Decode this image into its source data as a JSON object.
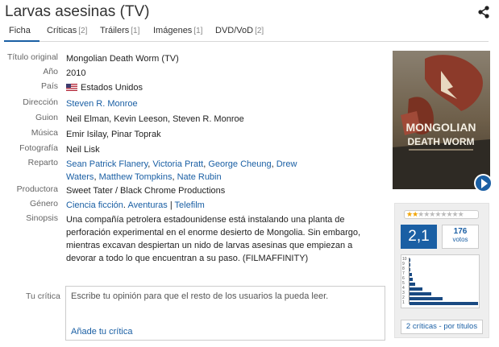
{
  "title": "Larvas asesinas (TV)",
  "share_icon": "share-icon",
  "tabs": [
    {
      "label": "Ficha",
      "count": ""
    },
    {
      "label": "Críticas",
      "count": "[2]"
    },
    {
      "label": "Tráilers",
      "count": "[1]"
    },
    {
      "label": "Imágenes",
      "count": "[1]"
    },
    {
      "label": "DVD/VoD",
      "count": "[2]"
    }
  ],
  "info": {
    "titulo_label": "Título original",
    "titulo": "Mongolian Death Worm (TV)",
    "ano_label": "Año",
    "ano": "2010",
    "pais_label": "País",
    "pais": "Estados Unidos",
    "direccion_label": "Dirección",
    "direccion": "Steven R. Monroe",
    "guion_label": "Guion",
    "guion": "Neil Elman, Kevin Leeson, Steven R. Monroe",
    "musica_label": "Música",
    "musica": "Emir Isilay, Pinar Toprak",
    "fotografia_label": "Fotografía",
    "fotografia": "Neil Lisk",
    "reparto_label": "Reparto",
    "reparto": [
      "Sean Patrick Flanery",
      "Victoria Pratt",
      "George Cheung",
      "Drew Waters",
      "Matthew Tompkins",
      "Nate Rubin"
    ],
    "productora_label": "Productora",
    "productora": "Sweet Tater / Black Chrome Productions",
    "genero_label": "Género",
    "genero": [
      "Ciencia ficción",
      "Aventuras",
      "Telefilm"
    ],
    "sinopsis_label": "Sinopsis",
    "sinopsis": "Una compañía petrolera estadounidense está instalando una planta de perforación experimental en el enorme desierto de Mongolia. Sin embargo, mientras excavan despiertan un nido de larvas asesinas que empiezan a devorar a todo lo que encuentran a su paso. (FILMAFFINITY)"
  },
  "poster": {
    "title_line1": "MONGOLIAN",
    "title_line2": "DEATH WORM"
  },
  "rating": {
    "average": "2,1",
    "stars_filled": 2,
    "stars_total": 10,
    "votes_count": "176",
    "votes_label": "votos",
    "histogram_ticks": [
      "10",
      "9",
      "8",
      "7",
      "6",
      "5",
      "4",
      "3",
      "2",
      "1"
    ],
    "histogram": [
      1,
      1,
      1,
      2,
      3,
      5,
      12,
      20,
      30,
      62
    ],
    "critics_button": "2 críticas - por títulos"
  },
  "review": {
    "label": "Tu crítica",
    "placeholder": "Escribe tu opinión para que el resto de los usuarios la pueda leer.",
    "add_link": "Añade tu crítica"
  },
  "colors": {
    "accent": "#1a5fa4",
    "histogram_bar": "#1a4a82",
    "star": "#f2a400"
  }
}
